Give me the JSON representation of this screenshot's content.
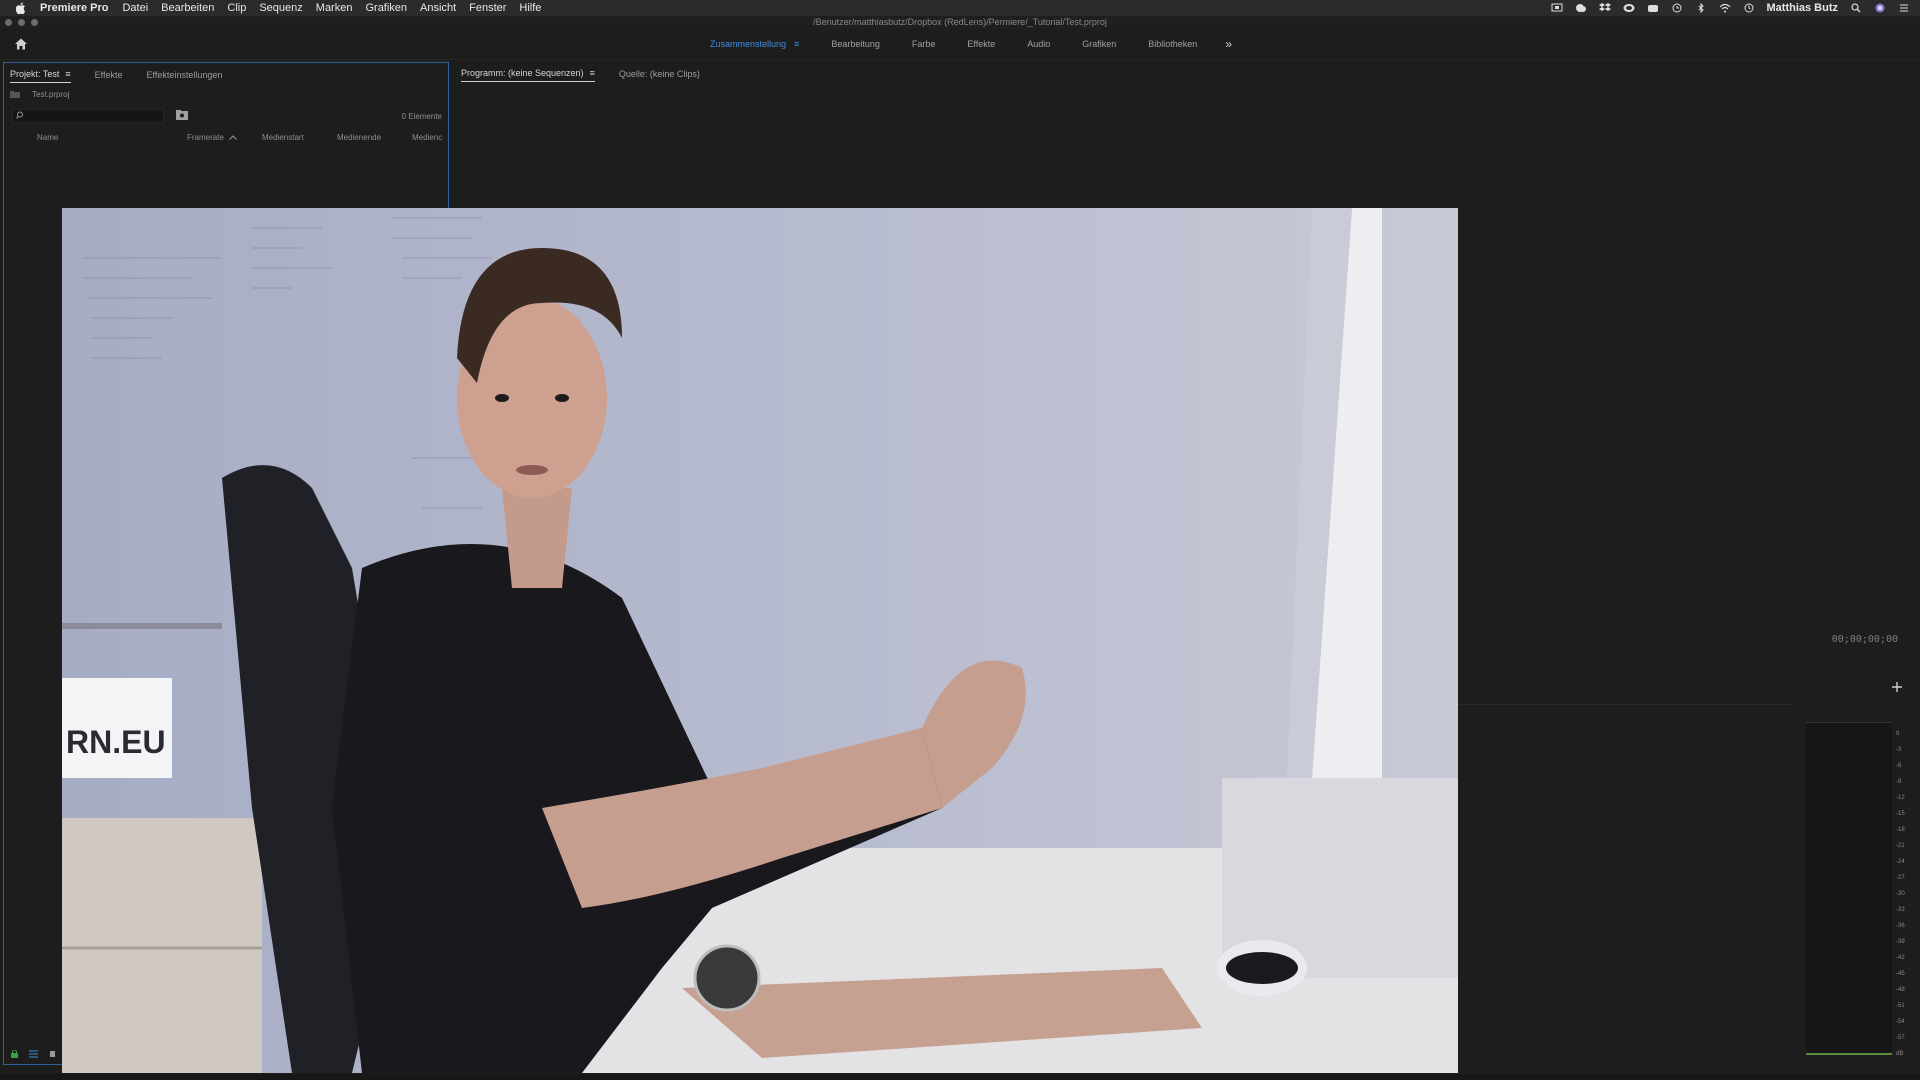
{
  "menubar": {
    "apple_icon": "apple-icon",
    "app_name": "Premiere Pro",
    "items": [
      "Datei",
      "Bearbeiten",
      "Clip",
      "Sequenz",
      "Marken",
      "Grafiken",
      "Ansicht",
      "Fenster",
      "Hilfe"
    ],
    "status_icons": [
      "screen-icon",
      "cloud-icon",
      "dropbox-icon",
      "creative-cloud-icon",
      "sync-icon",
      "time-machine-icon",
      "bluetooth-icon",
      "wifi-icon",
      "clock-icon"
    ],
    "user": "Matthias Butz"
  },
  "window": {
    "title_path": "/Benutzer/matthiasbutz/Dropbox (RedLens)/Permiere/_Tutorial/Test.prproj"
  },
  "workspace": {
    "tabs": [
      {
        "label": "Zusammenstellung",
        "active": true
      },
      {
        "label": "Bearbeitung",
        "active": false
      },
      {
        "label": "Farbe",
        "active": false
      },
      {
        "label": "Effekte",
        "active": false
      },
      {
        "label": "Audio",
        "active": false
      },
      {
        "label": "Grafiken",
        "active": false
      },
      {
        "label": "Bibliotheken",
        "active": false
      }
    ],
    "more": "»"
  },
  "project_panel": {
    "tabs": [
      {
        "label": "Projekt: Test",
        "active": true
      },
      {
        "label": "Effekte",
        "active": false
      },
      {
        "label": "Effekteinstellungen",
        "active": false
      }
    ],
    "file_name": "Test.prproj",
    "search_placeholder": "",
    "item_count": "0 Elemente",
    "columns": {
      "name": "Name",
      "framerate": "Framerate",
      "medienstart": "Medienstart",
      "medienende": "Medienende",
      "medienc": "Medienc"
    }
  },
  "monitor": {
    "tabs": [
      {
        "label": "Programm: (keine Sequenzen)",
        "active": true
      },
      {
        "label": "Quelle: (keine Clips)",
        "active": false
      }
    ],
    "timecode": "00;00;00;00"
  },
  "audio_meter": {
    "scale": [
      "0",
      "-3",
      "-6",
      "-9",
      "-12",
      "-15",
      "-18",
      "-21",
      "-24",
      "-27",
      "-30",
      "-33",
      "-36",
      "-39",
      "-42",
      "-45",
      "-48",
      "-51",
      "-54",
      "-57",
      "dB"
    ]
  },
  "video_overlay": {
    "sign_text": "RN.EU"
  },
  "colors": {
    "accent": "#3d8fe0",
    "panel_border": "#2f5f98",
    "background": "#1d1d1d"
  }
}
